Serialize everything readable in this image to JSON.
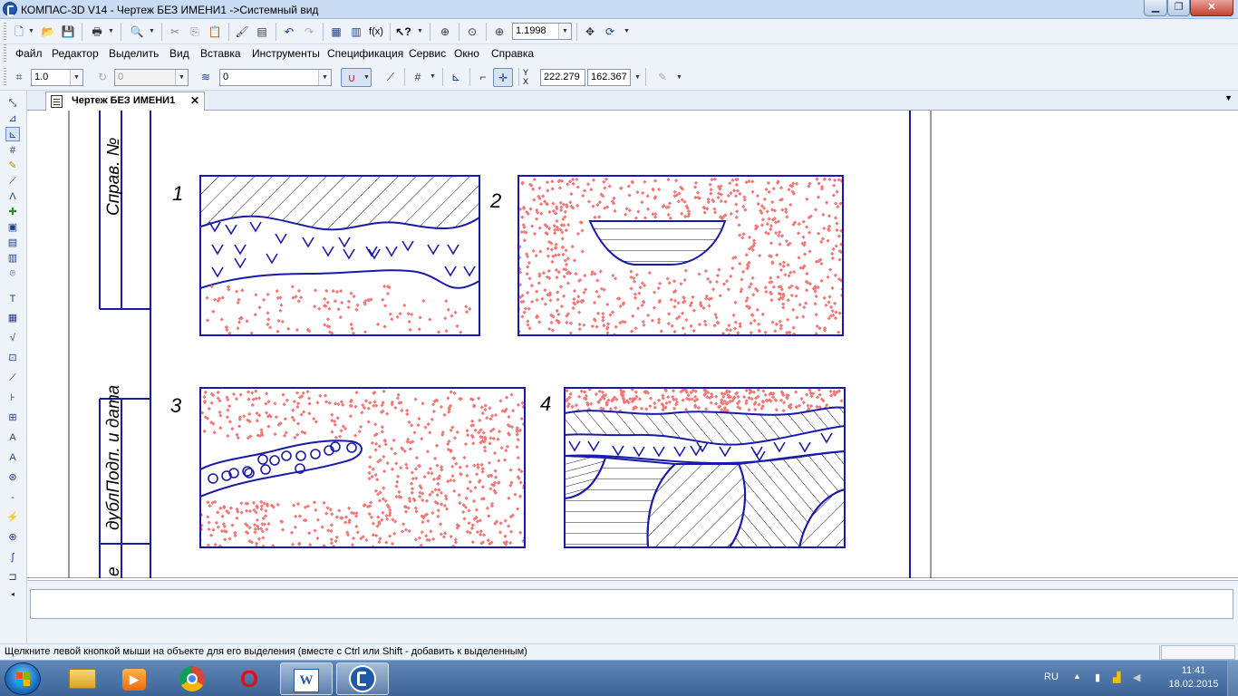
{
  "window": {
    "title": "КОМПАС-3D V14 - Чертеж БЕЗ ИМЕНИ1 ->Системный вид",
    "minimize_symbol": "▁",
    "maximize_symbol": "❐",
    "close_symbol": "✕"
  },
  "toolbar": {
    "zoom_value": "1.1998",
    "icons": [
      "new-document-icon",
      "open-icon",
      "save-icon",
      "print-icon",
      "preview-icon",
      "cut-icon",
      "copy-icon",
      "paste-icon",
      "format-brush-icon",
      "properties-icon",
      "undo-icon",
      "redo-icon",
      "manager-icon",
      "variables-icon",
      "fx-icon",
      "help-icon",
      "zoom-window-icon",
      "zoom-in-icon",
      "zoom-scale-icon",
      "pan-icon",
      "refresh-icon"
    ]
  },
  "menu": {
    "items": [
      "Файл",
      "Редактор",
      "Выделить",
      "Вид",
      "Вставка",
      "Инструменты",
      "Спецификация",
      "Сервис",
      "Окно",
      "Справка"
    ]
  },
  "toolbar2": {
    "step_value": "1.0",
    "angle_value": "0",
    "layer_value": "0",
    "coord_x": "222.279",
    "coord_y": "162.367",
    "coord_label_y": "Y",
    "coord_label_x": "X"
  },
  "document_tab": {
    "label": "Чертеж БЕЗ ИМЕНИ1",
    "close_symbol": "✕"
  },
  "drawing": {
    "stamp_label_top": "Справ. №",
    "stamp_label_bottom": "дублПодп. и дата",
    "stamp_label_bottom_prefix": "е",
    "panel_numbers": [
      "1",
      "2",
      "3",
      "4"
    ]
  },
  "statusbar": {
    "hint": "Щелкните левой кнопкой мыши на объекте для его выделения (вместе с Ctrl или Shift - добавить к выделенным)"
  },
  "taskbar": {
    "apps": [
      "explorer",
      "media-player",
      "chrome",
      "opera",
      "word",
      "kompas"
    ],
    "word_label": "W",
    "opera_label": "O",
    "language": "RU",
    "time": "11:41",
    "date": "18.02.2015"
  },
  "colors": {
    "drawing_line": "#1a1aa8",
    "dots": "#f07878",
    "frame": "#0000c0"
  }
}
